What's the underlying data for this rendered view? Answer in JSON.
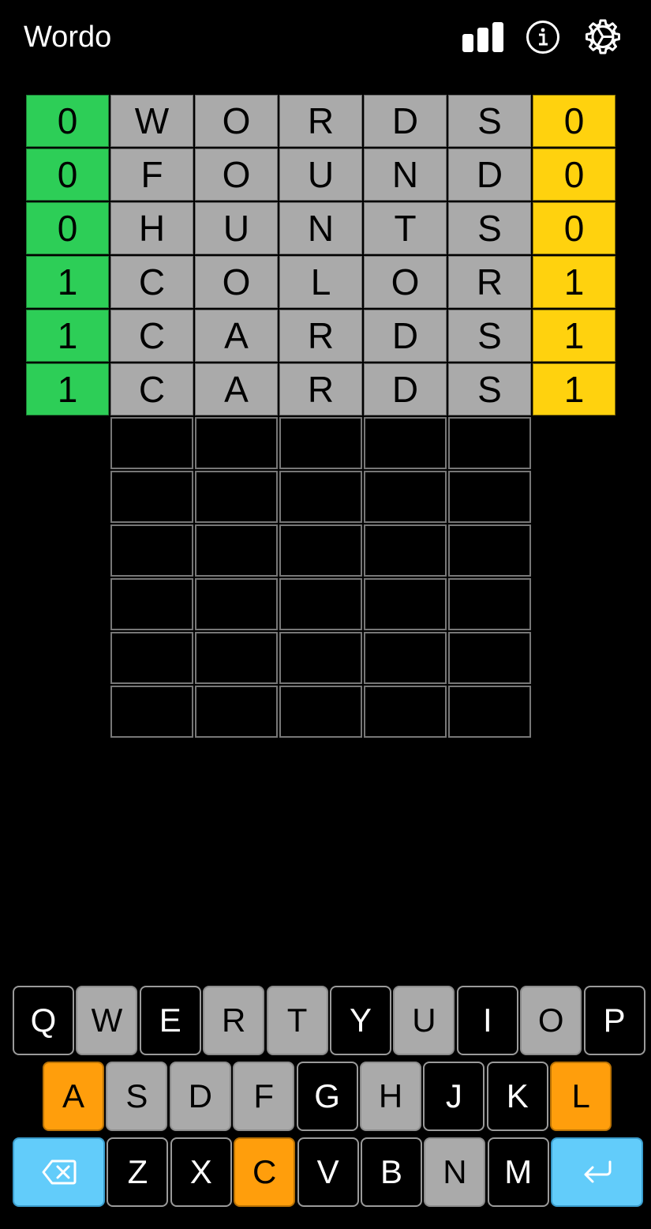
{
  "header": {
    "title": "Wordo",
    "icons": [
      "stats-icon",
      "info-icon",
      "settings-icon"
    ]
  },
  "colors": {
    "correct": "#2dce57",
    "present": "#ffd20e",
    "guess_tile": "#aaaaaa",
    "key_present": "#ff9e0c",
    "key_absent": "#aaaaaa",
    "key_action": "#62ccfa",
    "background": "#000000"
  },
  "board": {
    "guesses": [
      {
        "left": "0",
        "letters": [
          "W",
          "O",
          "R",
          "D",
          "S"
        ],
        "right": "0"
      },
      {
        "left": "0",
        "letters": [
          "F",
          "O",
          "U",
          "N",
          "D"
        ],
        "right": "0"
      },
      {
        "left": "0",
        "letters": [
          "H",
          "U",
          "N",
          "T",
          "S"
        ],
        "right": "0"
      },
      {
        "left": "1",
        "letters": [
          "C",
          "O",
          "L",
          "O",
          "R"
        ],
        "right": "1"
      },
      {
        "left": "1",
        "letters": [
          "C",
          "A",
          "R",
          "D",
          "S"
        ],
        "right": "1"
      },
      {
        "left": "1",
        "letters": [
          "C",
          "A",
          "R",
          "D",
          "S"
        ],
        "right": "1"
      }
    ],
    "empty_rows": 6,
    "columns": 5
  },
  "keyboard": {
    "rows": [
      [
        {
          "label": "Q",
          "state": "unused"
        },
        {
          "label": "W",
          "state": "absent"
        },
        {
          "label": "E",
          "state": "unused"
        },
        {
          "label": "R",
          "state": "absent"
        },
        {
          "label": "T",
          "state": "absent"
        },
        {
          "label": "Y",
          "state": "unused"
        },
        {
          "label": "U",
          "state": "absent"
        },
        {
          "label": "I",
          "state": "unused"
        },
        {
          "label": "O",
          "state": "absent"
        },
        {
          "label": "P",
          "state": "unused"
        }
      ],
      [
        {
          "label": "A",
          "state": "present"
        },
        {
          "label": "S",
          "state": "absent"
        },
        {
          "label": "D",
          "state": "absent"
        },
        {
          "label": "F",
          "state": "absent"
        },
        {
          "label": "G",
          "state": "unused"
        },
        {
          "label": "H",
          "state": "absent"
        },
        {
          "label": "J",
          "state": "unused"
        },
        {
          "label": "K",
          "state": "unused"
        },
        {
          "label": "L",
          "state": "present"
        }
      ],
      [
        {
          "label": "",
          "state": "action",
          "icon": "backspace-icon"
        },
        {
          "label": "Z",
          "state": "unused"
        },
        {
          "label": "X",
          "state": "unused"
        },
        {
          "label": "C",
          "state": "present"
        },
        {
          "label": "V",
          "state": "unused"
        },
        {
          "label": "B",
          "state": "unused"
        },
        {
          "label": "N",
          "state": "absent"
        },
        {
          "label": "M",
          "state": "unused"
        },
        {
          "label": "",
          "state": "action",
          "icon": "enter-icon"
        }
      ]
    ]
  }
}
